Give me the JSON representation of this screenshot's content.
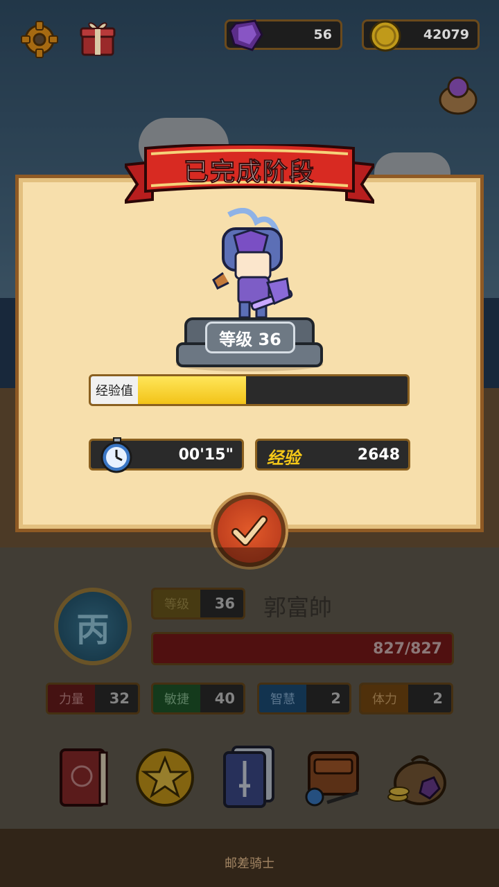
{
  "top_bar": {
    "gems": "56",
    "gold": "42079"
  },
  "dialog": {
    "title": "已完成阶段",
    "level_text": "等级 36",
    "exp_label": "经验值",
    "exp_progress": 0.4,
    "time": "00'15\"",
    "exp_word": "经验",
    "exp_gain": "2648"
  },
  "character": {
    "rank_char": "丙",
    "level_label": "等级",
    "level": "36",
    "name": "郭富帥",
    "hp": "827/827",
    "attributes": [
      {
        "label": "力量",
        "value": "32",
        "label_bg": "#6a1c1c",
        "label_color": "#c98c8c"
      },
      {
        "label": "敏捷",
        "value": "40",
        "label_bg": "#1f5a2c",
        "label_color": "#8cc296"
      },
      {
        "label": "智慧",
        "value": "2",
        "label_bg": "#1c4f7a",
        "label_color": "#8db5da"
      },
      {
        "label": "体力",
        "value": "2",
        "label_bg": "#7a4a12",
        "label_color": "#d6a86a"
      }
    ]
  },
  "menu": {
    "icons": [
      "book-icon",
      "star-coin-icon",
      "card-deck-icon",
      "backpack-icon",
      "treasure-bag-icon"
    ]
  },
  "footer": {
    "title": "邮差骑士"
  }
}
